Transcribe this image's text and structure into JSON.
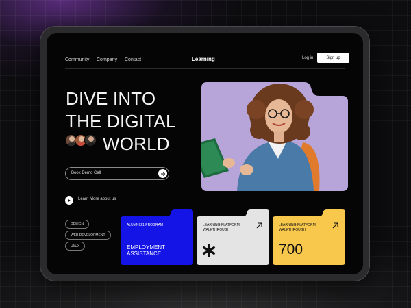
{
  "nav": {
    "links": [
      "Community",
      "Company",
      "Contact"
    ],
    "brand": "Learning",
    "login": "Log in",
    "signup": "Sign up"
  },
  "hero": {
    "line1": "DIVE INTO",
    "line2": "THE DIGITAL",
    "line3": "WORLD",
    "demo_label": "Book Demo Call",
    "learn_more": "Learn More about us"
  },
  "tags": [
    "DESIGN",
    "WEB DEVELOPMENT",
    "UI/UX"
  ],
  "cards": [
    {
      "label": "ALUMNI 21 PROGRAM",
      "title": "EMPLOYMENT ASSISTANCE",
      "color": "#1414e6",
      "text_color": "#ffffff"
    },
    {
      "label": "LEARNING PLATFORM WALKTHROUGH",
      "icon": "asterisk-icon",
      "color": "#e4e4e4",
      "text_color": "#111111"
    },
    {
      "label": "LEARNING PLATFORM WALKTHROUGH",
      "value": "700",
      "color": "#f8c84d",
      "text_color": "#111111"
    }
  ],
  "colors": {
    "photo_bg": "#b7a4d8",
    "accent_blue": "#1414e6",
    "accent_yellow": "#f8c84d"
  }
}
